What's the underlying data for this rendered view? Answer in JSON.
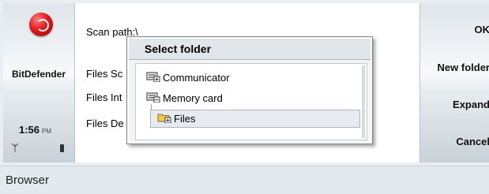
{
  "left_panel": {
    "app_name": "BitDefender",
    "clock": {
      "time": "1:56",
      "ampm": "PM"
    }
  },
  "main": {
    "scan_path": "Scan path:\\",
    "files_scanned": "Files Sc",
    "files_infected": "Files Int",
    "files_deleted": "Files De"
  },
  "softkeys": {
    "ok": "OK",
    "new_folder": "New folder",
    "expand": "Expand",
    "cancel": "Cancel"
  },
  "dialog": {
    "title": "Select folder",
    "items": [
      {
        "label": "Communicator",
        "icon": "drive-icon"
      },
      {
        "label": "Memory card",
        "icon": "memory-card-icon"
      },
      {
        "label": "Files",
        "icon": "folder-icon",
        "selected": true
      }
    ]
  },
  "status_bar": {
    "text": "Browser"
  },
  "colors": {
    "logo_red": "#e3181b",
    "folder_yellow": "#f1c84b",
    "selection_bg": "#e6ebef"
  }
}
